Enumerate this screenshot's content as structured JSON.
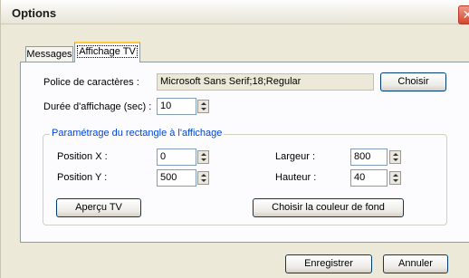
{
  "window": {
    "title": "Options",
    "close_glyph": "✕"
  },
  "tabs": [
    {
      "label": "Messages"
    },
    {
      "label": "Affichage TV"
    }
  ],
  "font": {
    "label": "Police de caractères :",
    "value": "Microsoft Sans Serif;18;Regular",
    "button": "Choisir"
  },
  "duration": {
    "label": "Durée d'affichage (sec) :",
    "value": "10"
  },
  "group": {
    "title": "Paramétrage du rectangle à l'affichage",
    "pos_x": {
      "label": "Position X :",
      "value": "0"
    },
    "pos_y": {
      "label": "Position Y :",
      "value": "500"
    },
    "width": {
      "label": "Largeur :",
      "value": "800"
    },
    "height": {
      "label": "Hauteur :",
      "value": "40"
    },
    "preview_button": "Aperçu TV",
    "bgcolor_button": "Choisir la couleur de fond"
  },
  "footer": {
    "save_button": "Enregistrer",
    "cancel_button": "Annuler"
  }
}
